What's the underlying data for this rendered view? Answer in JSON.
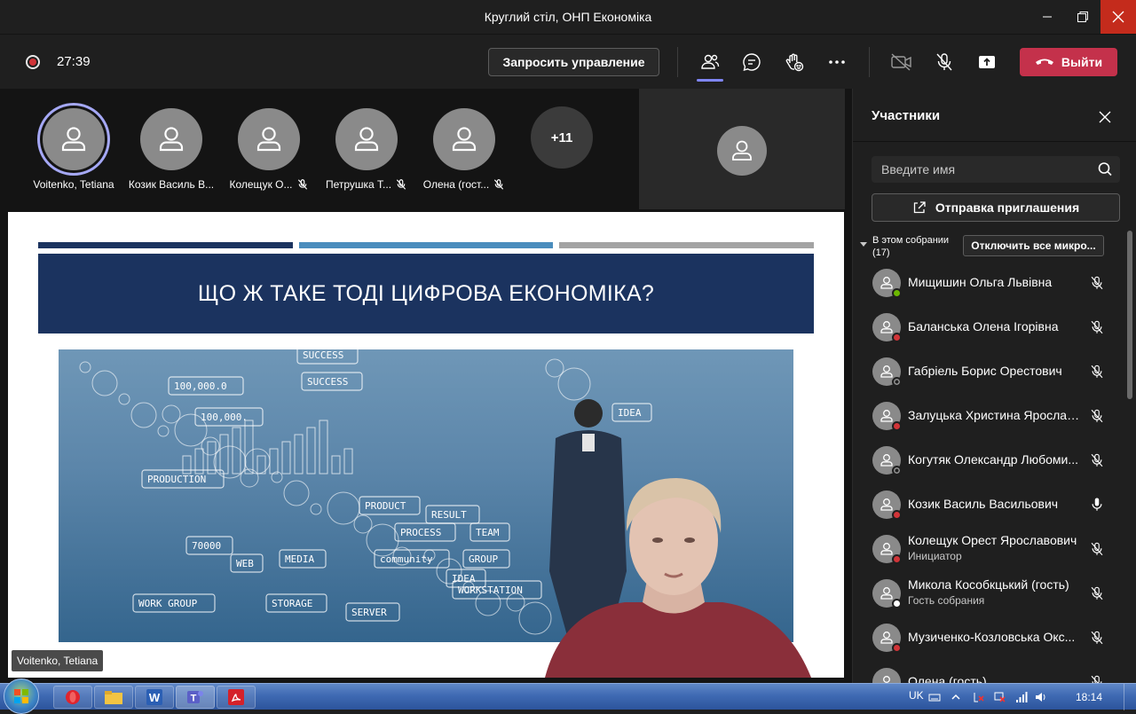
{
  "window": {
    "title": "Круглий стіл, ОНП Економіка"
  },
  "toolbar": {
    "timer": "27:39",
    "request_control_label": "Запросить управление",
    "leave_label": "Выйти"
  },
  "stage": {
    "tiles": [
      {
        "name": "Voitenko, Tetiana",
        "muted": false,
        "speaking": true
      },
      {
        "name": "Козик Василь В...",
        "muted": false,
        "speaking": false
      },
      {
        "name": "Колещук О...",
        "muted": true,
        "speaking": false
      },
      {
        "name": "Петрушка Т...",
        "muted": true,
        "speaking": false
      },
      {
        "name": "Олена (гост...",
        "muted": true,
        "speaking": false
      }
    ],
    "more_count": "+11",
    "presenter_label": "Voitenko, Tetiana"
  },
  "slide": {
    "title": "ЩО Ж ТАКЕ ТОДІ ЦИФРОВА ЕКОНОМІКА?",
    "bar_colors": [
      "#1b335f",
      "#4a8dbd",
      "#a3a3a3"
    ],
    "image_words": [
      "SUCCESS",
      "PRODUCTION",
      "PRODUCT",
      "RESULT",
      "PROCESS",
      "TEAM",
      "MEDIA",
      "community",
      "GROUP",
      "IDEA",
      "WORK GROUP",
      "STORAGE",
      "SERVER",
      "WEB",
      "SUCCESS",
      "100,000.0",
      "100,000.",
      "70000",
      "WORKSTATION",
      "IDEA"
    ]
  },
  "panel": {
    "title": "Участники",
    "search_placeholder": "Введите имя",
    "invite_label": "Отправка приглашения",
    "section_label": "В этом собрании (17)",
    "mute_all_label": "Отключить все микро...",
    "participants": [
      {
        "name": "Мищишин Ольга Львівна",
        "sub": "",
        "status": "available",
        "mic": "muted"
      },
      {
        "name": "Баланська Олена Ігорівна",
        "sub": "",
        "status": "busy",
        "mic": "muted"
      },
      {
        "name": "Габріель Борис Орестович",
        "sub": "",
        "status": "offline",
        "mic": "muted"
      },
      {
        "name": "Залуцька Христина Ярославі...",
        "sub": "",
        "status": "busy",
        "mic": "muted"
      },
      {
        "name": "Когутяк Олександр Любоми...",
        "sub": "",
        "status": "offline",
        "mic": "muted"
      },
      {
        "name": "Козик Василь Васильович",
        "sub": "",
        "status": "busy",
        "mic": "on"
      },
      {
        "name": "Колещук Орест Ярославович",
        "sub": "Инициатор",
        "status": "busy",
        "mic": "muted"
      },
      {
        "name": "Микола Кособкцький (гость)",
        "sub": "Гость собрания",
        "status": "guest",
        "mic": "muted"
      },
      {
        "name": "Музиченко-Козловська Окс...",
        "sub": "",
        "status": "busy",
        "mic": "muted"
      },
      {
        "name": "Олена (гость)",
        "sub": "",
        "status": "busy",
        "mic": "muted"
      }
    ]
  },
  "taskbar": {
    "language": "UK",
    "clock": "18:14"
  },
  "colors": {
    "accent": "#7f85f5",
    "leave": "#c4314b",
    "close": "#c42b1c",
    "available": "#6bb700",
    "busy": "#d13438"
  }
}
